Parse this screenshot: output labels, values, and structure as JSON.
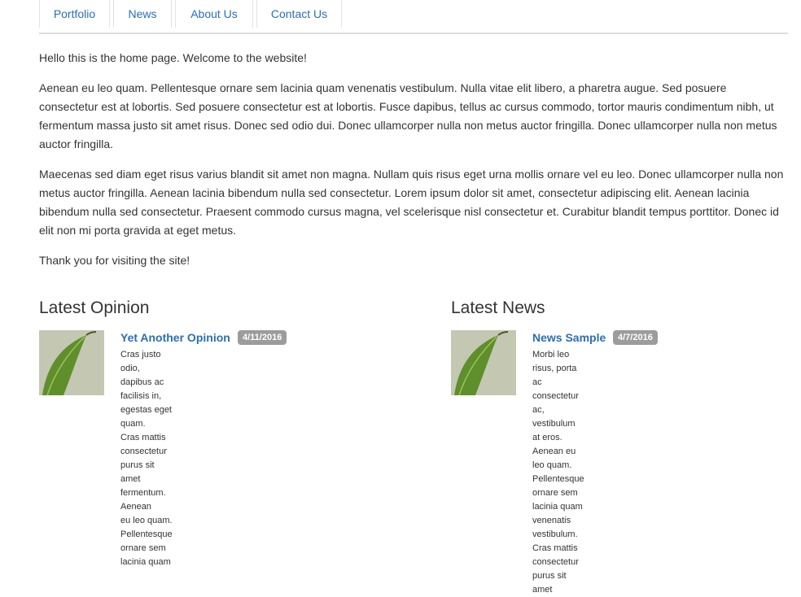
{
  "nav": {
    "tabs": [
      {
        "label": "Portfolio"
      },
      {
        "label": "News"
      },
      {
        "label": "About Us"
      },
      {
        "label": "Contact Us"
      }
    ]
  },
  "content": {
    "greeting": "Hello this is the home page. Welcome to the website!",
    "paragraph1": "Aenean eu leo quam. Pellentesque ornare sem lacinia quam venenatis vestibulum. Nulla vitae elit libero, a pharetra augue. Sed posuere consectetur est at lobortis. Sed posuere consectetur est at lobortis. Fusce dapibus, tellus ac cursus commodo, tortor mauris condimentum nibh, ut fermentum massa justo sit amet risus. Donec sed odio dui. Donec ullamcorper nulla non metus auctor fringilla. Donec ullamcorper nulla non metus auctor fringilla.",
    "paragraph2": "Maecenas sed diam eget risus varius blandit sit amet non magna. Nullam quis risus eget urna mollis ornare vel eu leo. Donec ullamcorper nulla non metus auctor fringilla. Aenean lacinia bibendum nulla sed consectetur. Lorem ipsum dolor sit amet, consectetur adipiscing elit. Aenean lacinia bibendum nulla sed consectetur. Praesent commodo cursus magna, vel scelerisque nisl consectetur et. Curabitur blandit tempus porttitor. Donec id elit non mi porta gravida at eget metus.",
    "closing": "Thank you for visiting the site!"
  },
  "opinion": {
    "heading": "Latest Opinion",
    "article": {
      "title": "Yet Another Opinion",
      "date": "4/11/2016",
      "excerpt_lines": [
        "Cras justo odio, dapibus ac facilisis in, egestas eget quam.",
        "Cras mattis consectetur purus sit amet fermentum. Aenean",
        "eu leo quam. Pellentesque ornare sem lacinia quam"
      ]
    }
  },
  "news": {
    "heading": "Latest News",
    "article": {
      "title": "News Sample",
      "date": "4/7/2016",
      "excerpt_lines": [
        "Morbi leo risus, porta ac consectetur ac, vestibulum at eros.",
        "Aenean eu leo quam. Pellentesque ornare sem lacinia quam",
        "venenatis vestibulum. Cras mattis consectetur purus sit amet"
      ]
    }
  },
  "colors": {
    "link": "#2a6fb5",
    "text": "#333333",
    "badge": "#9c9c9c",
    "divider": "#dddddd"
  }
}
